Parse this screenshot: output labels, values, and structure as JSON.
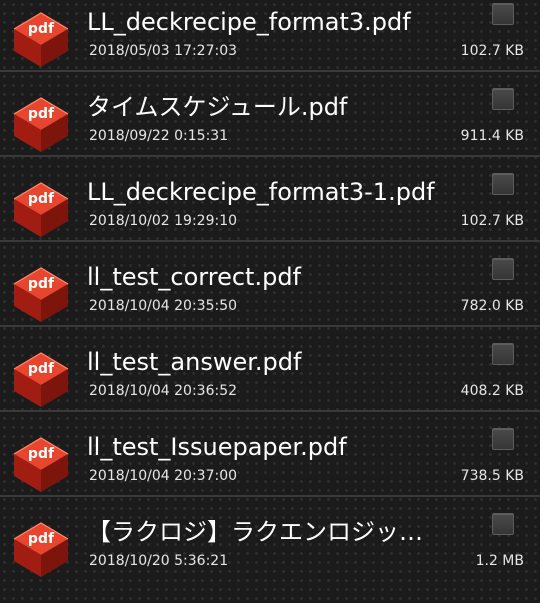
{
  "icon_label": "pdf",
  "colors": {
    "background": "#1b1b1b",
    "divider": "#3a3a3a",
    "icon_red": "#c8271a",
    "text": "#ffffff"
  },
  "files": [
    {
      "name": "LL_deckrecipe_format3.pdf",
      "date": "2018/05/03 17:27:03",
      "size": "102.7 KB",
      "checked": false,
      "icon": "pdf-icon"
    },
    {
      "name": "タイムスケジュール.pdf",
      "date": "2018/09/22 0:15:31",
      "size": "911.4 KB",
      "checked": false,
      "icon": "pdf-icon"
    },
    {
      "name": "LL_deckrecipe_format3-1.pdf",
      "date": "2018/10/02 19:29:10",
      "size": "102.7 KB",
      "checked": false,
      "icon": "pdf-icon"
    },
    {
      "name": "ll_test_correct.pdf",
      "date": "2018/10/04 20:35:50",
      "size": "782.0 KB",
      "checked": false,
      "icon": "pdf-icon"
    },
    {
      "name": "ll_test_answer.pdf",
      "date": "2018/10/04 20:36:52",
      "size": "408.2 KB",
      "checked": false,
      "icon": "pdf-icon"
    },
    {
      "name": "ll_test_Issuepaper.pdf",
      "date": "2018/10/04 20:37:00",
      "size": "738.5 KB",
      "checked": false,
      "icon": "pdf-icon"
    },
    {
      "name": "【ラクロジ】ラクエンロジッ…",
      "date": "2018/10/20 5:36:21",
      "size": "1.2 MB",
      "checked": false,
      "icon": "pdf-icon"
    }
  ]
}
